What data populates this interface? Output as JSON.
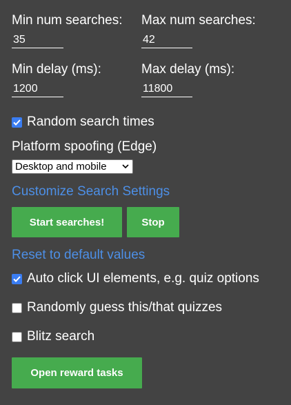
{
  "settings": {
    "min_searches": {
      "label": "Min num searches:",
      "value": "35"
    },
    "max_searches": {
      "label": "Max num searches:",
      "value": "42"
    },
    "min_delay": {
      "label": "Min delay (ms):",
      "value": "1200"
    },
    "max_delay": {
      "label": "Max delay (ms):",
      "value": "11800"
    }
  },
  "random_times": {
    "label": "Random search times",
    "checked": true
  },
  "platform": {
    "label": "Platform spoofing (Edge)",
    "selected": "Desktop and mobile"
  },
  "links": {
    "customize": "Customize Search Settings",
    "reset": "Reset to default values"
  },
  "buttons": {
    "start": "Start searches!",
    "stop": "Stop",
    "open_rewards": "Open reward tasks"
  },
  "options": {
    "auto_click": {
      "label": "Auto click UI elements, e.g. quiz options",
      "checked": true
    },
    "random_guess": {
      "label": "Randomly guess this/that quizzes",
      "checked": false
    },
    "blitz": {
      "label": "Blitz search",
      "checked": false
    }
  },
  "colors": {
    "background": "#434343",
    "button": "#46ab4e",
    "link": "#4d8fe6",
    "checkbox": "#3a7df2"
  }
}
